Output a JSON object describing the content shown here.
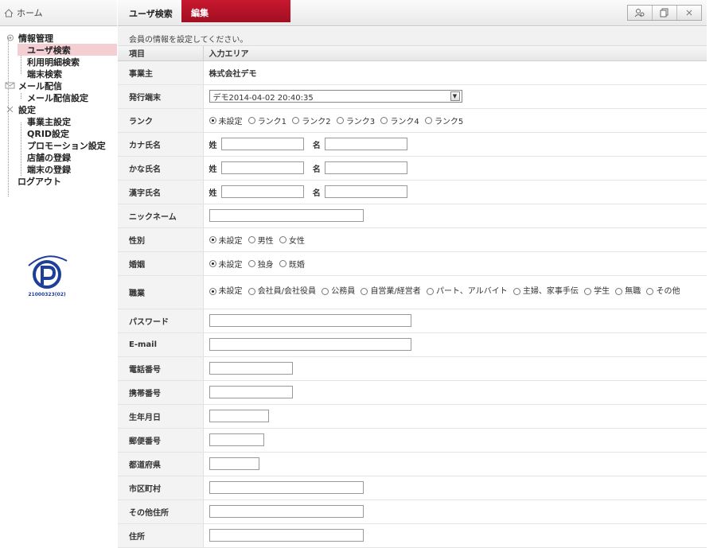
{
  "sidebar": {
    "home": "ホーム",
    "groups": [
      {
        "label": "情報管理",
        "items": [
          "ユーザ検索",
          "利用明細検索",
          "端末検索"
        ]
      },
      {
        "label": "メール配信",
        "items": [
          "メール配信設定"
        ]
      },
      {
        "label": "設定",
        "items": [
          "事業主設定",
          "QRID設定",
          "プロモーション設定",
          "店舗の登録",
          "端末の登録"
        ]
      }
    ],
    "logout": "ログアウト",
    "badge_number": "21000323(02)"
  },
  "header": {
    "tab_search": "ユーザ検索",
    "tab_edit": "編集"
  },
  "notice": "会員の情報を設定してください。",
  "table": {
    "col_item": "項目",
    "col_input": "入力エリア",
    "rows": {
      "owner": {
        "label": "事業主",
        "value": "株式会社デモ"
      },
      "terminal": {
        "label": "発行端末",
        "value": "デモ2014-04-02 20:40:35"
      },
      "rank": {
        "label": "ランク",
        "options": [
          "未設定",
          "ランク1",
          "ランク2",
          "ランク3",
          "ランク4",
          "ランク5"
        ]
      },
      "kana_name": {
        "label": "カナ氏名",
        "sei": "姓",
        "mei": "名"
      },
      "hira_name": {
        "label": "かな氏名",
        "sei": "姓",
        "mei": "名"
      },
      "kanji_name": {
        "label": "漢字氏名",
        "sei": "姓",
        "mei": "名"
      },
      "nickname": {
        "label": "ニックネーム"
      },
      "gender": {
        "label": "性別",
        "options": [
          "未設定",
          "男性",
          "女性"
        ]
      },
      "marriage": {
        "label": "婚姻",
        "options": [
          "未設定",
          "独身",
          "既婚"
        ]
      },
      "job": {
        "label": "職業",
        "options": [
          "未設定",
          "会社員/会社役員",
          "公務員",
          "自営業/経営者",
          "パート、アルバイト",
          "主婦、家事手伝",
          "学生",
          "無職",
          "その他"
        ]
      },
      "password": {
        "label": "パスワード"
      },
      "email": {
        "label": "E-mail"
      },
      "phone": {
        "label": "電話番号"
      },
      "mobile": {
        "label": "携帯番号"
      },
      "birthday": {
        "label": "生年月日"
      },
      "zip": {
        "label": "郵便番号"
      },
      "pref": {
        "label": "都道府県"
      },
      "city": {
        "label": "市区町村"
      },
      "other_addr": {
        "label": "その他住所"
      },
      "address": {
        "label": "住所"
      }
    }
  },
  "colors": {
    "accent": "#b3142a",
    "active_bg": "#f3cfd3",
    "badge_blue": "#1f3e9a"
  }
}
